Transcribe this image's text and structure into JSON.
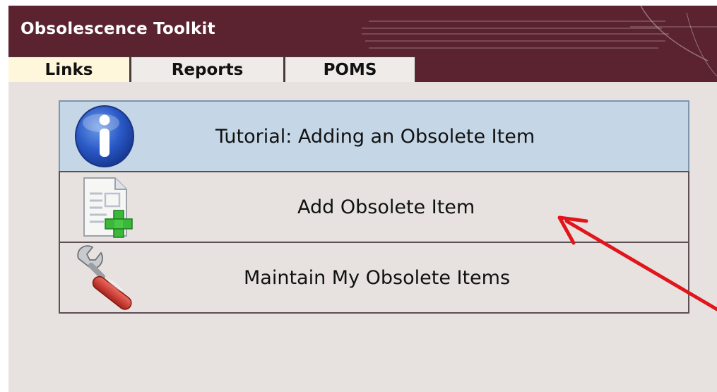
{
  "app": {
    "title": "Obsolescence Toolkit"
  },
  "tabs": [
    {
      "label": "Links",
      "active": true
    },
    {
      "label": "Reports",
      "active": false
    },
    {
      "label": "POMS",
      "active": false
    }
  ],
  "links": [
    {
      "label": "Tutorial: Adding an Obsolete Item",
      "icon": "info-icon",
      "highlighted": true
    },
    {
      "label": "Add Obsolete Item",
      "icon": "add-document-icon",
      "highlighted": false
    },
    {
      "label": "Maintain My Obsolete Items",
      "icon": "wrench-icon",
      "highlighted": false
    }
  ],
  "colors": {
    "header": "#5a232f",
    "background": "#e7e2df",
    "active_tab": "#fff7dc",
    "highlight_row": "#c5d6e6",
    "annotation_arrow": "#e0161c"
  }
}
